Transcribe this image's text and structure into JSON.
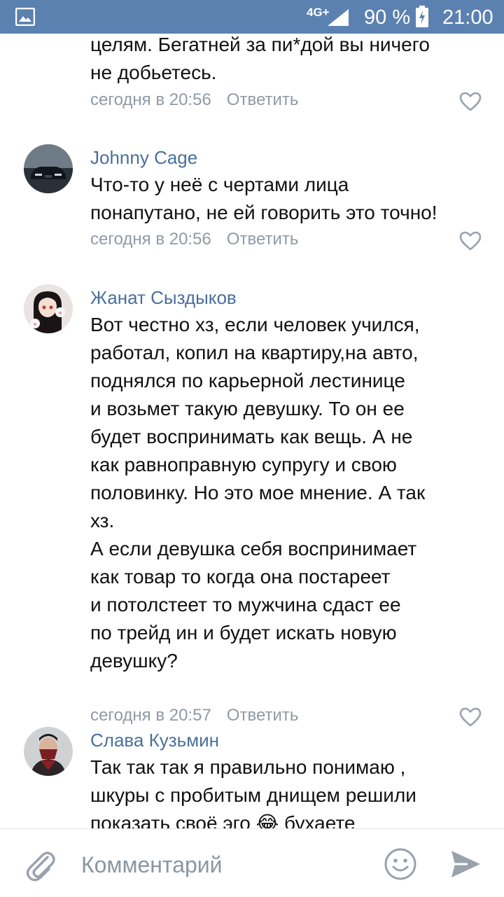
{
  "status_bar": {
    "network": "4G+",
    "battery_percent": "90 %",
    "time": "21:00"
  },
  "comments": [
    {
      "author": "",
      "text": "целям. Бегатней за пи*дой вы ничего\nне добьетесь.",
      "time": "сегодня в 20:56",
      "reply_label": "Ответить"
    },
    {
      "author": "Johnny Cage",
      "text": "Что-то у неё с чертами лица\nпонапутано, не ей говорить это точно!",
      "time": "сегодня в 20:56",
      "reply_label": "Ответить"
    },
    {
      "author": "Жанат Сыздыков",
      "text": "Вот честно хз, если человек учился,\nработал, копил на квартиру,на авто,\nподнялся по карьерной лестинице\nи возьмет такую девушку. То он ее\nбудет воспринимать как вещь. А не\nкак равноправную супругу и свою\nполовинку. Но это мое мнение. А так\nхз.\nА если девушка себя воспринимает\nкак товар то когда она постареет\nи потолстеет то мужчина сдаст ее\nпо трейд ин и будет искать новую\nдевушку?",
      "time": "сегодня в 20:57",
      "reply_label": "Ответить"
    },
    {
      "author": "Слава Кузьмин",
      "text": "Так так так я правильно понимаю ,\nшкуры с пробитым днищем решили\nпоказать своё эго 😂 бухаете",
      "time": "",
      "reply_label": ""
    }
  ],
  "composer": {
    "placeholder": "Комментарий"
  },
  "icons": {
    "status": [
      "gallery-icon",
      "signal-icon",
      "battery-icon"
    ],
    "composer": [
      "attach-icon",
      "emoji-icon",
      "send-icon"
    ],
    "comment": [
      "like-icon"
    ]
  },
  "colors": {
    "status_bar": "#5b81b0",
    "author": "#4a6f9c",
    "meta": "#909aa6",
    "icon": "#99a2ad"
  }
}
